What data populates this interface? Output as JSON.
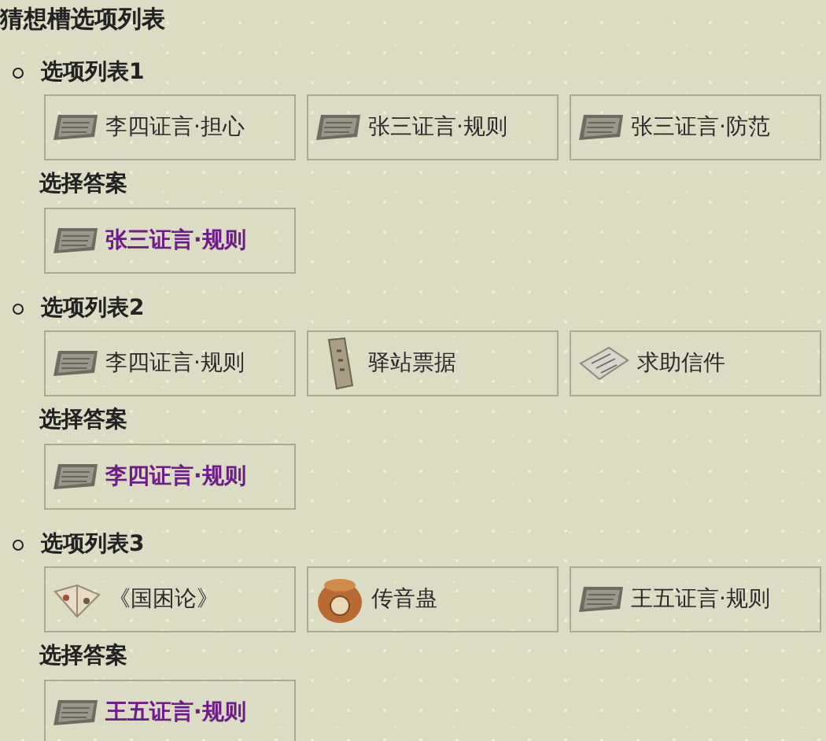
{
  "title": "猜想槽选项列表",
  "sections": [
    {
      "heading": "选项列表1",
      "options": [
        {
          "kind": "testimony",
          "label": "李四证言·担心"
        },
        {
          "kind": "testimony",
          "label": "张三证言·规则"
        },
        {
          "kind": "testimony",
          "label": "张三证言·防范"
        }
      ],
      "answer_heading": "选择答案",
      "answer": {
        "kind": "testimony",
        "label": "张三证言·规则"
      }
    },
    {
      "heading": "选项列表2",
      "options": [
        {
          "kind": "testimony",
          "label": "李四证言·规则"
        },
        {
          "kind": "ticket",
          "label": "驿站票据"
        },
        {
          "kind": "letter",
          "label": "求助信件"
        }
      ],
      "answer_heading": "选择答案",
      "answer": {
        "kind": "testimony",
        "label": "李四证言·规则"
      }
    },
    {
      "heading": "选项列表3",
      "options": [
        {
          "kind": "book",
          "label": "《国困论》"
        },
        {
          "kind": "jar",
          "label": "传音蛊"
        },
        {
          "kind": "testimony",
          "label": "王五证言·规则"
        }
      ],
      "answer_heading": "选择答案",
      "answer": {
        "kind": "testimony",
        "label": "王五证言·规则"
      }
    }
  ]
}
